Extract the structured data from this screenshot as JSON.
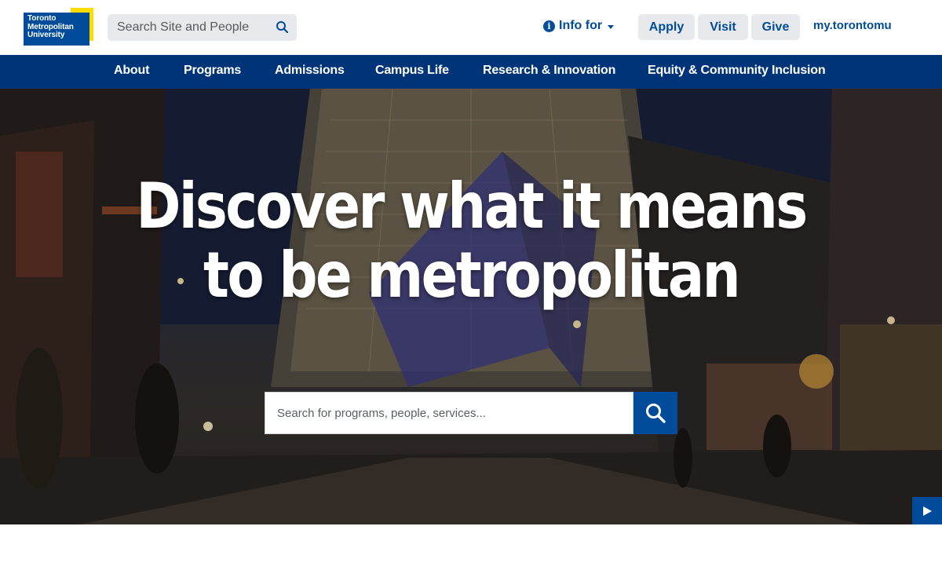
{
  "logo": {
    "line1": "Toronto",
    "line2": "Metropolitan",
    "line3": "University",
    "blue": "#004c9b",
    "yellow": "#ffdc00"
  },
  "site_search": {
    "placeholder": "Search Site and People",
    "icon": "search-icon"
  },
  "utility": {
    "info_for": "Info for",
    "apply": "Apply",
    "visit": "Visit",
    "give": "Give",
    "my_link": "my.torontomu"
  },
  "nav": {
    "items": [
      {
        "label": "About"
      },
      {
        "label": "Programs"
      },
      {
        "label": "Admissions"
      },
      {
        "label": "Campus Life"
      },
      {
        "label": "Research & Innovation"
      },
      {
        "label": "Equity & Community Inclusion"
      }
    ],
    "background": "#003479"
  },
  "hero": {
    "headline_line1": "Discover what it means",
    "headline_line2": "to be metropolitan",
    "search_placeholder": "Search for programs, people, services...",
    "search_icon": "search-icon",
    "play_icon": "play-icon"
  }
}
